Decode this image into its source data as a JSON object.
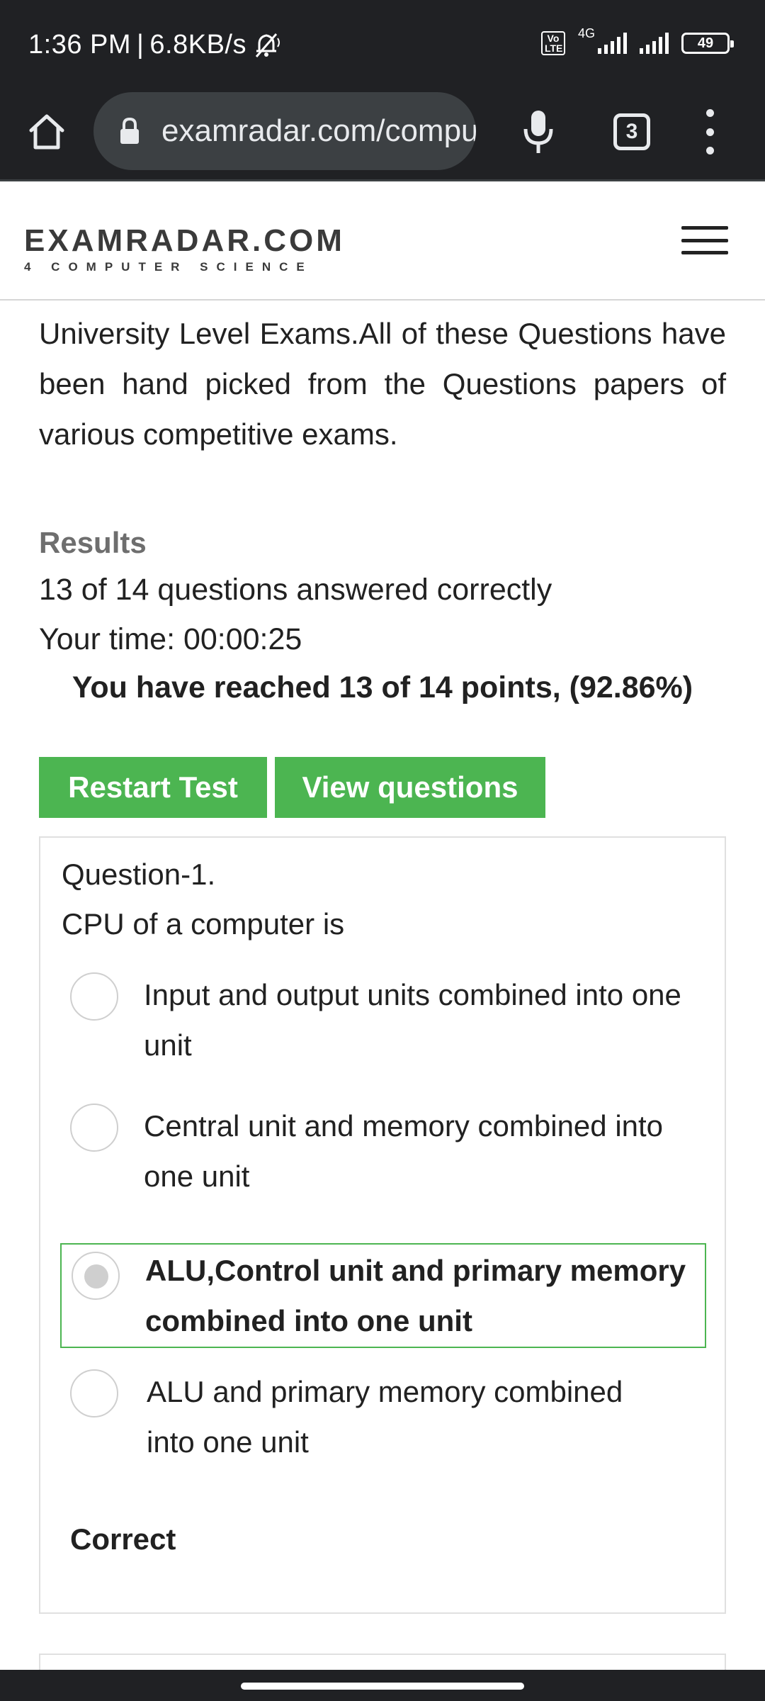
{
  "status_bar": {
    "time": "1:36 PM",
    "separator": "|",
    "speed": "6.8KB/s",
    "volte": "Vo LTE",
    "network": "4G",
    "battery": "49"
  },
  "browser": {
    "url": "examradar.com/computer-fundamentals",
    "tab_count": "3"
  },
  "site": {
    "logo_main": "EXAMRADAR.COM",
    "logo_sub": "4 COMPUTER SCIENCE"
  },
  "content": {
    "intro": "University Level Exams.All of these Questions have been hand picked from the Questions papers of various competitive exams.",
    "results_heading": "Results",
    "answered": "13 of 14 questions answered correctly",
    "time": "Your time: 00:00:25",
    "score": "You have reached 13 of 14 points, (92.86%)",
    "restart_label": "Restart Test",
    "view_label": "View questions"
  },
  "question": {
    "number": "Question-1.",
    "text": "CPU of a computer is",
    "options": [
      {
        "label": "Input and output units combined into one unit",
        "selected": false
      },
      {
        "label": "Central unit and memory combined into one unit",
        "selected": false
      },
      {
        "label": "ALU,Control unit and primary memory combined into one unit",
        "selected": true
      },
      {
        "label": "ALU and primary memory combined into one unit",
        "selected": false
      }
    ],
    "result": "Correct"
  },
  "colors": {
    "accent_green": "#4cb551",
    "chrome_dark": "#202124"
  }
}
